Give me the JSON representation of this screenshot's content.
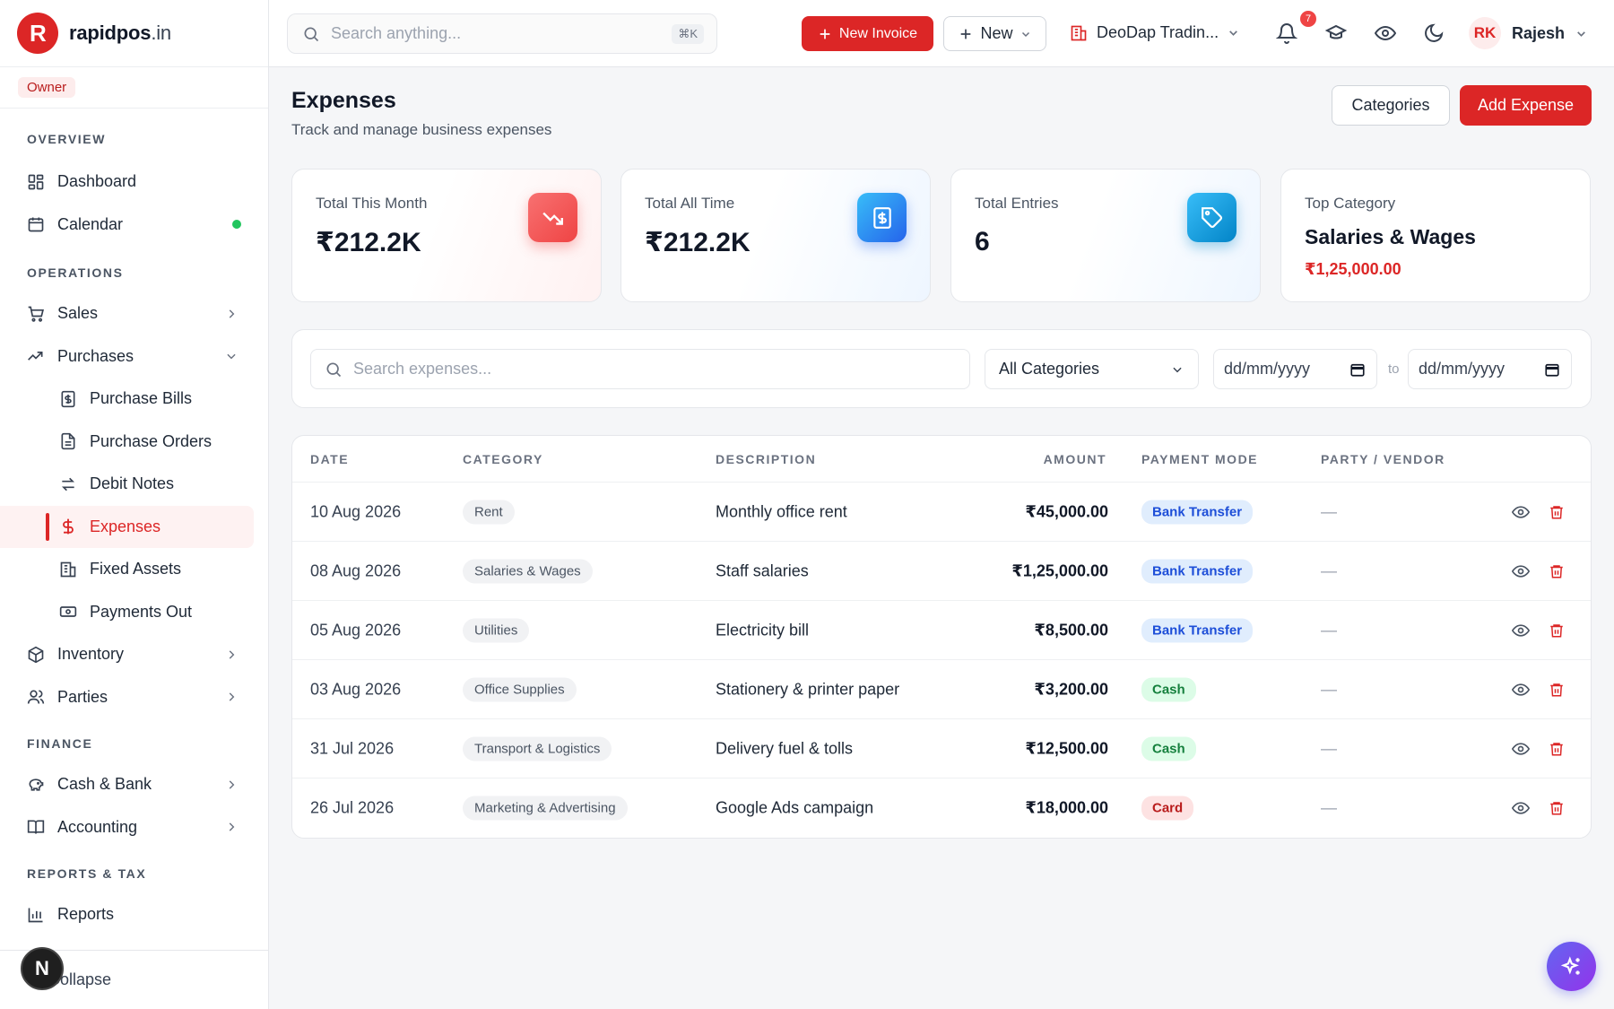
{
  "brand": {
    "name": "rapidpos",
    "tld": ".in",
    "logo_letter": "R"
  },
  "role": "Owner",
  "sidebar": {
    "sections": [
      {
        "title": "OVERVIEW"
      },
      {
        "title": "OPERATIONS"
      },
      {
        "title": "FINANCE"
      },
      {
        "title": "REPORTS & TAX"
      }
    ],
    "items": {
      "dashboard": "Dashboard",
      "calendar": "Calendar",
      "sales": "Sales",
      "purchases": "Purchases",
      "purchase_bills": "Purchase Bills",
      "purchase_orders": "Purchase Orders",
      "debit_notes": "Debit Notes",
      "expenses": "Expenses",
      "fixed_assets": "Fixed Assets",
      "payments_out": "Payments Out",
      "inventory": "Inventory",
      "parties": "Parties",
      "cash_bank": "Cash & Bank",
      "accounting": "Accounting",
      "reports": "Reports"
    },
    "collapse_label": "Collapse",
    "n_badge": "N"
  },
  "topbar": {
    "search_placeholder": "Search anything...",
    "search_shortcut": "⌘K",
    "new_invoice_label": "New Invoice",
    "new_label": "New",
    "company": "DeoDap Tradin...",
    "notification_count": "7",
    "user_initials": "RK",
    "user_name": "Rajesh"
  },
  "page": {
    "title": "Expenses",
    "subtitle": "Track and manage business expenses",
    "categories_button": "Categories",
    "add_button": "Add Expense"
  },
  "stats": {
    "month": {
      "label": "Total This Month",
      "value": "₹212.2K"
    },
    "all_time": {
      "label": "Total All Time",
      "value": "₹212.2K"
    },
    "entries": {
      "label": "Total Entries",
      "value": "6"
    },
    "top": {
      "label": "Top Category",
      "value": "Salaries & Wages",
      "amount": "₹1,25,000.00"
    }
  },
  "filters": {
    "search_placeholder": "Search expenses...",
    "category_selected": "All Categories",
    "date_from_placeholder": "dd/mm/yyyy",
    "date_sep": "to",
    "date_to_placeholder": "dd/mm/yyyy"
  },
  "table": {
    "headers": {
      "date": "DATE",
      "category": "CATEGORY",
      "description": "DESCRIPTION",
      "amount": "AMOUNT",
      "payment_mode": "PAYMENT MODE",
      "vendor": "PARTY / VENDOR"
    },
    "rows": [
      {
        "date": "10 Aug 2026",
        "category": "Rent",
        "description": "Monthly office rent",
        "amount": "₹45,000.00",
        "mode": "Bank Transfer",
        "vendor": "—"
      },
      {
        "date": "08 Aug 2026",
        "category": "Salaries & Wages",
        "description": "Staff salaries",
        "amount": "₹1,25,000.00",
        "mode": "Bank Transfer",
        "vendor": "—"
      },
      {
        "date": "05 Aug 2026",
        "category": "Utilities",
        "description": "Electricity bill",
        "amount": "₹8,500.00",
        "mode": "Bank Transfer",
        "vendor": "—"
      },
      {
        "date": "03 Aug 2026",
        "category": "Office Supplies",
        "description": "Stationery & printer paper",
        "amount": "₹3,200.00",
        "mode": "Cash",
        "vendor": "—"
      },
      {
        "date": "31 Jul 2026",
        "category": "Transport & Logistics",
        "description": "Delivery fuel & tolls",
        "amount": "₹12,500.00",
        "mode": "Cash",
        "vendor": "—"
      },
      {
        "date": "26 Jul 2026",
        "category": "Marketing & Advertising",
        "description": "Google Ads campaign",
        "amount": "₹18,000.00",
        "mode": "Card",
        "vendor": "—"
      }
    ]
  },
  "colors": {
    "brand_red": "#dc2626",
    "month_icon": "#ef4444",
    "alltime_icon": "#0ea5e9",
    "entries_icon": "#0ea5e9",
    "fab": "#7c3aed"
  }
}
